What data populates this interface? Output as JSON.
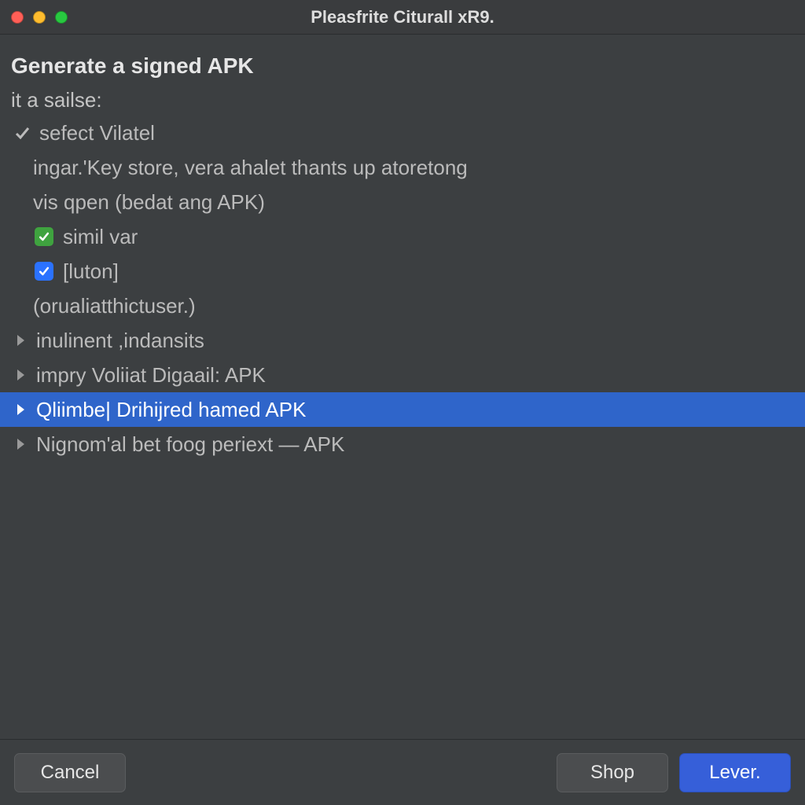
{
  "window": {
    "title": "Pleasfrite Citurall xR9."
  },
  "main": {
    "heading": "Generate a signed APK",
    "subheading": "it a sailse:",
    "items": [
      {
        "kind": "check",
        "label": "sefect Vilatel"
      },
      {
        "kind": "text",
        "label": "ingar.'Key store, vera ahalet thants up atoretong"
      },
      {
        "kind": "text",
        "label": "vis qpen (bedat ang APK)"
      },
      {
        "kind": "cboxg",
        "label": "simil var"
      },
      {
        "kind": "cboxb",
        "label": "[luton]"
      },
      {
        "kind": "text",
        "label": "(orualiatthictuser.)"
      },
      {
        "kind": "chev",
        "label": "inulinent ,indansits"
      },
      {
        "kind": "chev",
        "label": "impry Voliiat Digaail: APK"
      },
      {
        "kind": "chev",
        "label": "Qliimbe| Drihijred hamed APK",
        "selected": true
      },
      {
        "kind": "chev",
        "label": "Nignom'al bet foog periext — APK"
      }
    ]
  },
  "buttons": {
    "cancel": "Cancel",
    "shop": "Shop",
    "lever": "Lever."
  }
}
